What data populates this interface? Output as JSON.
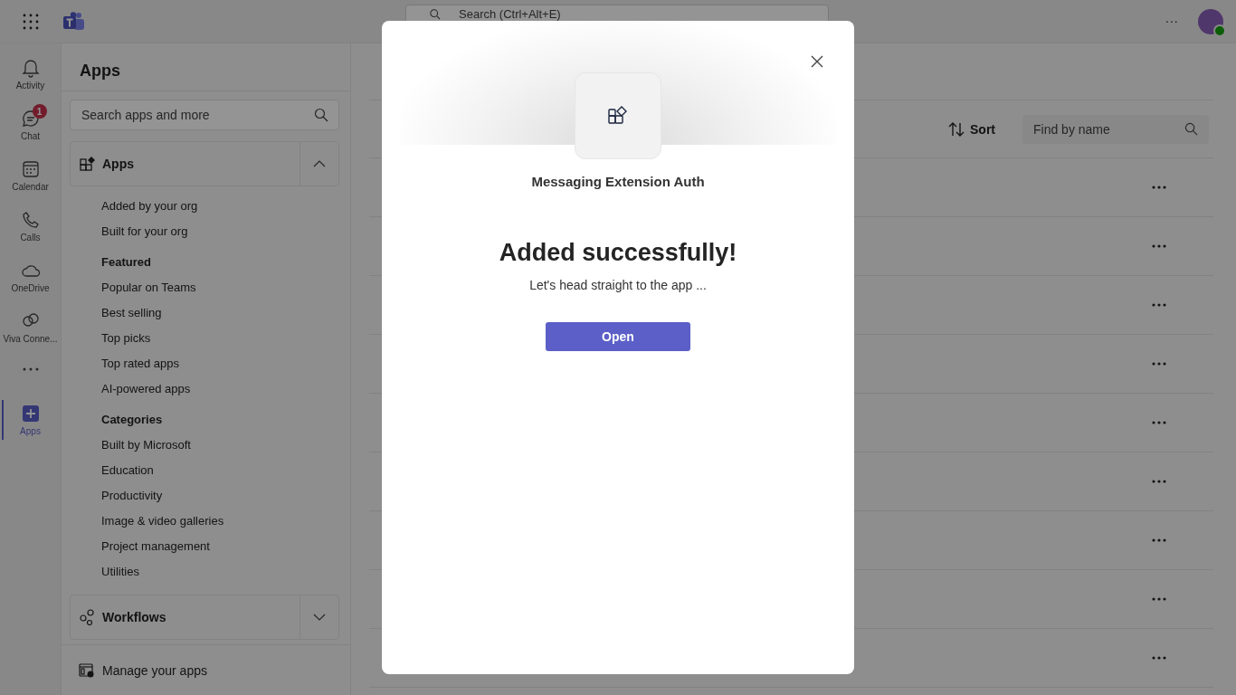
{
  "top_bar": {
    "search": {
      "placeholder": "Search (Ctrl+Alt+E)"
    },
    "more": "..."
  },
  "rail": [
    {
      "label": "Activity",
      "selected": false
    },
    {
      "label": "Chat",
      "selected": false,
      "badge": "1"
    },
    {
      "label": "Calendar",
      "selected": false
    },
    {
      "label": "Calls",
      "selected": false
    },
    {
      "label": "OneDrive",
      "selected": false
    },
    {
      "label": "Viva Conne...",
      "selected": false
    },
    {
      "label": "Apps",
      "selected": true
    }
  ],
  "sidebar": {
    "title": "Apps",
    "search": {
      "placeholder": "Search apps and more"
    },
    "sections": [
      {
        "title": "Apps",
        "expanded": true,
        "groups": [
          {
            "items": [
              "Added by your org",
              "Built for your org"
            ]
          },
          {
            "heading": "Featured",
            "items": [
              "Popular on Teams",
              "Best selling",
              "Top picks",
              "Top rated apps",
              "AI-powered apps"
            ]
          },
          {
            "heading": "Categories",
            "items": [
              "Built by Microsoft",
              "Education",
              "Productivity",
              "Image & video galleries",
              "Project management",
              "Utilities"
            ]
          }
        ]
      },
      {
        "title": "Workflows",
        "expanded": false
      }
    ],
    "footer": "Manage your apps"
  },
  "main": {
    "sort": "Sort",
    "find": {
      "placeholder": "Find by name"
    },
    "rows": [
      {
        "kind": "app-row"
      },
      {
        "kind": "app-row"
      },
      {
        "kind": "app-row"
      },
      {
        "kind": "app-row"
      },
      {
        "kind": "app-row"
      },
      {
        "kind": "app-row"
      },
      {
        "kind": "app-row"
      },
      {
        "kind": "app-row"
      },
      {
        "kind": "app-row"
      }
    ]
  },
  "dialog": {
    "app_name": "Messaging Extension Auth",
    "title": "Added successfully!",
    "message": "Let's head straight to the app ...",
    "button": "Open"
  }
}
